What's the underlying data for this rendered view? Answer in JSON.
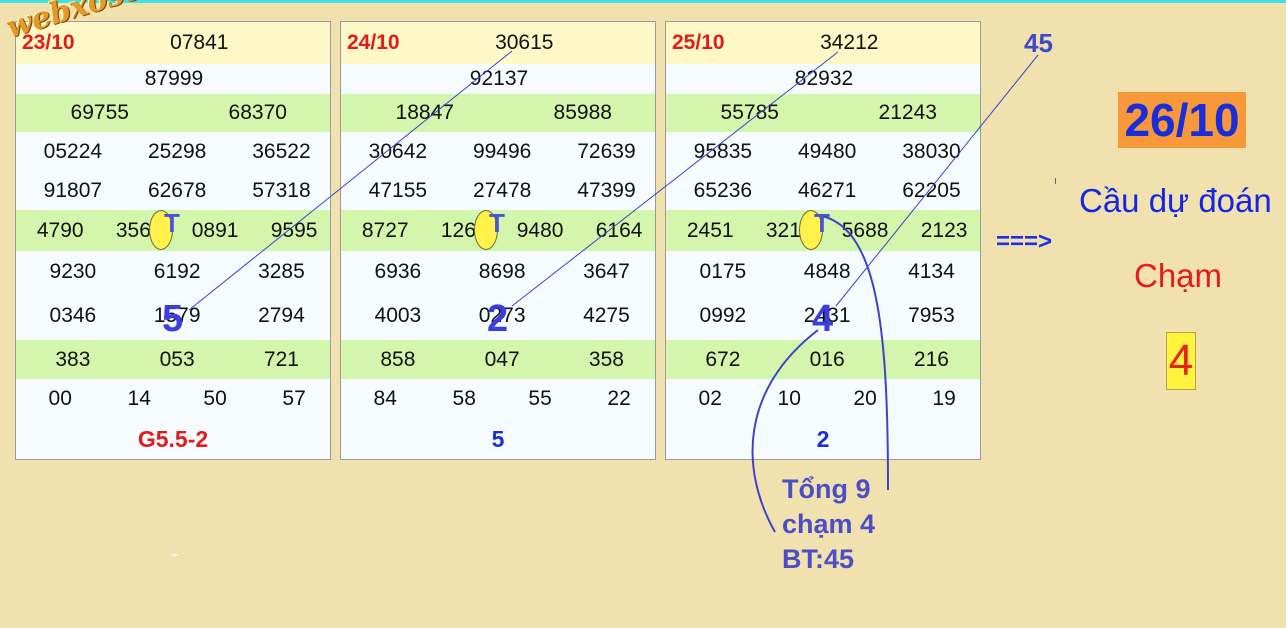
{
  "watermark": "webxoso.net",
  "panels": [
    {
      "date": "23/10",
      "rows": [
        [
          "07841"
        ],
        [
          "87999"
        ],
        [
          "69755",
          "68370"
        ],
        [
          "05224",
          "25298",
          "36522"
        ],
        [
          "91807",
          "62678",
          "57318"
        ],
        [
          "4790",
          "3566",
          "0891",
          "9595"
        ],
        [
          "9230",
          "6192",
          "3285"
        ],
        [
          "0346",
          "1579",
          "2794"
        ],
        [
          "383",
          "053",
          "721"
        ],
        [
          "00",
          "14",
          "50",
          "57"
        ]
      ],
      "footer": "G5.5-2",
      "footer_color": "#e31b1b",
      "marker": "T",
      "big_digit": "5"
    },
    {
      "date": "24/10",
      "rows": [
        [
          "30615"
        ],
        [
          "92137"
        ],
        [
          "18847",
          "85988"
        ],
        [
          "30642",
          "99496",
          "72639"
        ],
        [
          "47155",
          "27478",
          "47399"
        ],
        [
          "8727",
          "1263",
          "9480",
          "6164"
        ],
        [
          "6936",
          "8698",
          "3647"
        ],
        [
          "4003",
          "0273",
          "4275"
        ],
        [
          "858",
          "047",
          "358"
        ],
        [
          "84",
          "58",
          "55",
          "22"
        ]
      ],
      "footer": "5",
      "footer_color": "#1a2ddb",
      "marker": "T",
      "big_digit": "2"
    },
    {
      "date": "25/10",
      "rows": [
        [
          "34212"
        ],
        [
          "82932"
        ],
        [
          "55785",
          "21243"
        ],
        [
          "95835",
          "49480",
          "38030"
        ],
        [
          "65236",
          "46271",
          "62205"
        ],
        [
          "2451",
          "3219",
          "5688",
          "2123"
        ],
        [
          "0175",
          "4848",
          "4134"
        ],
        [
          "0992",
          "2431",
          "7953"
        ],
        [
          "672",
          "016",
          "216"
        ],
        [
          "02",
          "10",
          "20",
          "19"
        ]
      ],
      "footer": "2",
      "footer_color": "#1a2ddb",
      "marker": "T",
      "big_digit": "4"
    }
  ],
  "bt_label": "45",
  "arrow": "===>",
  "predict_date": "26/10",
  "forecast_label": "Cầu dự đoán",
  "cham_label": "Chạm",
  "result": "4",
  "notes": [
    "Tổng 9",
    "chạm 4",
    "BT:45"
  ],
  "colors": {
    "background": "#f1e1ae",
    "date_red": "#e31b1b",
    "row_green": "#d4f6ac",
    "row_header": "#fdf8c6",
    "highlight_yellow": "#fff24a",
    "accent_blue": "#1a2ddb",
    "note_blue": "#4a4fc8"
  }
}
